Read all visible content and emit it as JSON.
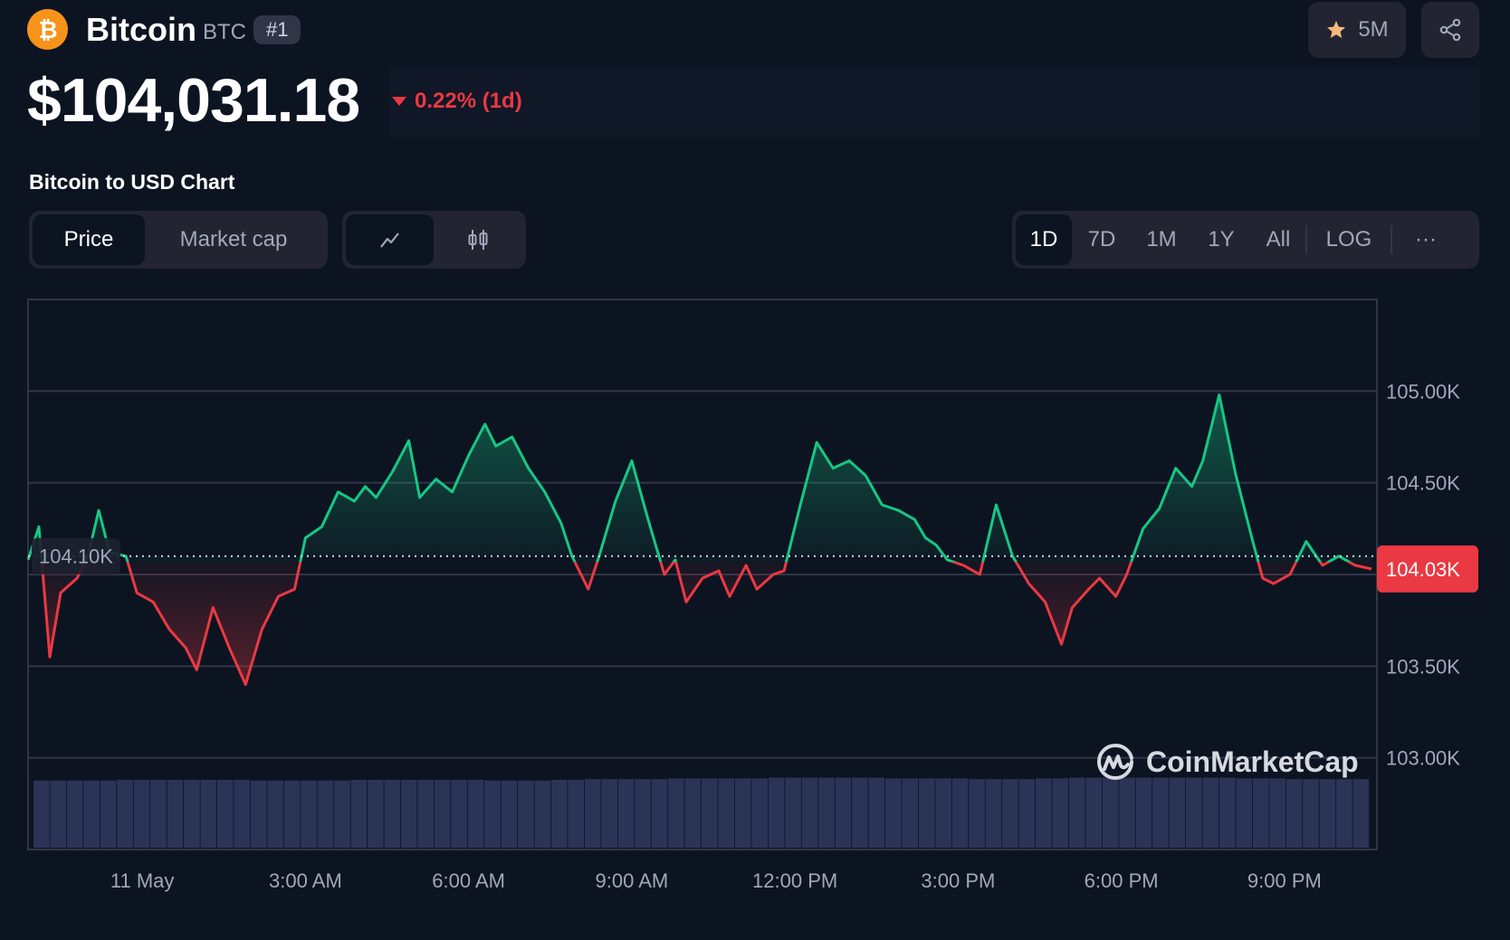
{
  "coin": {
    "name": "Bitcoin",
    "symbol": "BTC",
    "rank": "#1"
  },
  "price": {
    "value": "$104,031.18",
    "change": "0.22% (1d)",
    "direction": "down"
  },
  "watchlist": {
    "count": "5M"
  },
  "chart_title": "Bitcoin to USD Chart",
  "metric_tabs": [
    {
      "label": "Price",
      "active": true
    },
    {
      "label": "Market cap",
      "active": false
    }
  ],
  "view_modes": [
    {
      "icon": "line-chart-icon",
      "active": true
    },
    {
      "icon": "candlestick-icon",
      "active": false
    }
  ],
  "ranges": [
    {
      "label": "1D",
      "active": true
    },
    {
      "label": "7D"
    },
    {
      "label": "1M"
    },
    {
      "label": "1Y"
    },
    {
      "label": "All"
    }
  ],
  "log_label": "LOG",
  "more_label": "···",
  "watermark": "CoinMarketCap",
  "colors": {
    "up": "#16c784",
    "down": "#ea3943",
    "background": "#0d1421",
    "panel": "#222531",
    "accent": "#f7931a"
  },
  "chart_data": {
    "type": "area",
    "baseline": {
      "value": 104.1,
      "label": "104.10K"
    },
    "current": {
      "value": 104.03,
      "label": "104.03K"
    },
    "y_ticks": [
      {
        "value": 105.0,
        "label": "105.00K"
      },
      {
        "value": 104.5,
        "label": "104.50K"
      },
      {
        "value": 104.0,
        "label": ""
      },
      {
        "value": 103.5,
        "label": "103.50K"
      },
      {
        "value": 103.0,
        "label": "103.00K"
      }
    ],
    "ylim": [
      102.5,
      105.5
    ],
    "x_ticks": [
      "11 May",
      "3:00 AM",
      "6:00 AM",
      "9:00 AM",
      "12:00 PM",
      "3:00 PM",
      "6:00 PM",
      "9:00 PM"
    ],
    "x_tick_hours": [
      1,
      4,
      7,
      10,
      13,
      16,
      19,
      22
    ],
    "x_range_hours": [
      -1.1,
      23.7
    ],
    "series": [
      {
        "hours": [
          -1.1,
          -0.9,
          -0.7,
          -0.5,
          -0.2,
          0.0,
          0.2,
          0.4,
          0.7,
          0.9,
          1.2,
          1.5,
          1.8,
          2.0,
          2.3,
          2.6,
          2.9,
          3.2,
          3.5,
          3.8,
          4.0,
          4.3,
          4.6,
          4.9,
          5.1,
          5.3,
          5.6,
          5.9,
          6.1,
          6.4,
          6.7,
          7.0,
          7.3,
          7.5,
          7.8,
          8.1,
          8.4,
          8.7,
          8.9,
          9.2,
          9.4,
          9.7,
          10.0,
          10.3,
          10.6,
          10.8,
          11.0,
          11.3,
          11.6,
          11.8,
          12.1,
          12.3,
          12.6,
          12.8,
          13.1,
          13.4,
          13.7,
          14.0,
          14.3,
          14.6,
          14.9,
          15.2,
          15.4,
          15.6,
          15.8,
          16.1,
          16.4,
          16.7,
          17.0,
          17.3,
          17.6,
          17.9,
          18.1,
          18.4,
          18.6,
          18.9,
          19.1,
          19.4,
          19.7,
          20.0,
          20.3,
          20.5,
          20.8,
          21.1,
          21.4,
          21.6,
          21.8,
          22.1,
          22.4,
          22.7,
          23.0,
          23.3,
          23.6
        ],
        "values": [
          104.08,
          104.26,
          103.55,
          103.9,
          103.98,
          104.1,
          104.35,
          104.12,
          104.1,
          103.9,
          103.85,
          103.7,
          103.6,
          103.48,
          103.82,
          103.6,
          103.4,
          103.7,
          103.88,
          103.92,
          104.2,
          104.26,
          104.45,
          104.4,
          104.48,
          104.42,
          104.56,
          104.73,
          104.42,
          104.52,
          104.45,
          104.65,
          104.82,
          104.7,
          104.75,
          104.58,
          104.45,
          104.28,
          104.1,
          103.92,
          104.1,
          104.4,
          104.62,
          104.3,
          104.0,
          104.08,
          103.85,
          103.98,
          104.02,
          103.88,
          104.05,
          103.92,
          104.0,
          104.02,
          104.38,
          104.72,
          104.58,
          104.62,
          104.54,
          104.38,
          104.35,
          104.3,
          104.2,
          104.16,
          104.08,
          104.05,
          104.0,
          104.38,
          104.1,
          103.95,
          103.85,
          103.62,
          103.82,
          103.92,
          103.98,
          103.88,
          104.0,
          104.25,
          104.36,
          104.58,
          104.48,
          104.62,
          104.98,
          104.55,
          104.2,
          103.98,
          103.95,
          104.0,
          104.18,
          104.05,
          104.1,
          104.05,
          104.03
        ]
      }
    ],
    "volume_relative": [
      0.94,
      0.94,
      0.94,
      0.94,
      0.94,
      0.95,
      0.95,
      0.95,
      0.95,
      0.95,
      0.95,
      0.95,
      0.95,
      0.94,
      0.94,
      0.94,
      0.94,
      0.94,
      0.94,
      0.95,
      0.95,
      0.95,
      0.95,
      0.95,
      0.95,
      0.95,
      0.95,
      0.94,
      0.94,
      0.94,
      0.94,
      0.95,
      0.95,
      0.96,
      0.96,
      0.96,
      0.96,
      0.96,
      0.97,
      0.97,
      0.97,
      0.97,
      0.97,
      0.97,
      0.98,
      0.98,
      0.98,
      0.98,
      0.98,
      0.98,
      0.98,
      0.97,
      0.97,
      0.97,
      0.97,
      0.97,
      0.96,
      0.96,
      0.96,
      0.96,
      0.97,
      0.97,
      0.98,
      0.98,
      0.98,
      0.98,
      0.98,
      0.98,
      0.98,
      0.98,
      0.98,
      0.98,
      0.97,
      0.97,
      0.97,
      0.96,
      0.96,
      0.96,
      0.96,
      0.96
    ]
  }
}
